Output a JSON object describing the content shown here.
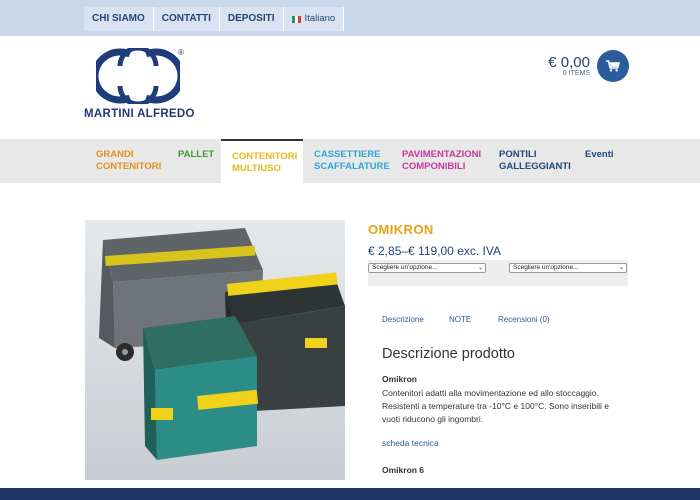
{
  "topnav": {
    "items": [
      {
        "label": "CHI SIAMO"
      },
      {
        "label": "CONTATTI"
      },
      {
        "label": "DEPOSITI"
      }
    ],
    "language": "Italiano"
  },
  "brand": {
    "name": "MARTINI ALFREDO",
    "registered": "®",
    "color": "#1e3b7a"
  },
  "cart": {
    "total": "€ 0,00",
    "items": "0 ITEMS",
    "icon": "shopping-cart-icon"
  },
  "mainnav": {
    "items": [
      {
        "label": "GRANDI\nCONTENITORI",
        "color": "#e98b1e"
      },
      {
        "label": "PALLET",
        "color": "#3c9a2e"
      },
      {
        "label": "CONTENITORI\nMULTIUSO",
        "color": "#e7b818",
        "active": true
      },
      {
        "label": "CASSETTIERE\nSCAFFALATURE",
        "color": "#31a7d4"
      },
      {
        "label": "PAVIMENTAZIONI\nCOMPONIBILI",
        "color": "#c43a9a"
      },
      {
        "label": "PONTILI\nGALLEGGIANTI",
        "color": "#23457a"
      },
      {
        "label": "Eventi",
        "color": "#23457a"
      }
    ]
  },
  "product": {
    "title": "OMIKRON",
    "price": "€ 2,85–€ 119,00 exc. IVA",
    "select1": "Scegliere un'opzione...",
    "select2": "Scegliere un'opzione...",
    "tabs": [
      "Descrizione",
      "NOTE",
      "Recensioni (0)"
    ],
    "description_heading": "Descrizione prodotto",
    "description_name": "Omikron",
    "description_text": "Contenitori adatti alla movimentazione ed allo stoccaggio. Resistenti a temperature tra -10°C e 100°C. Sono inseribili e vuoti riducono gli ingombri.",
    "datasheet_link": "scheda tecnica",
    "variant_name": "Omikron 6"
  }
}
